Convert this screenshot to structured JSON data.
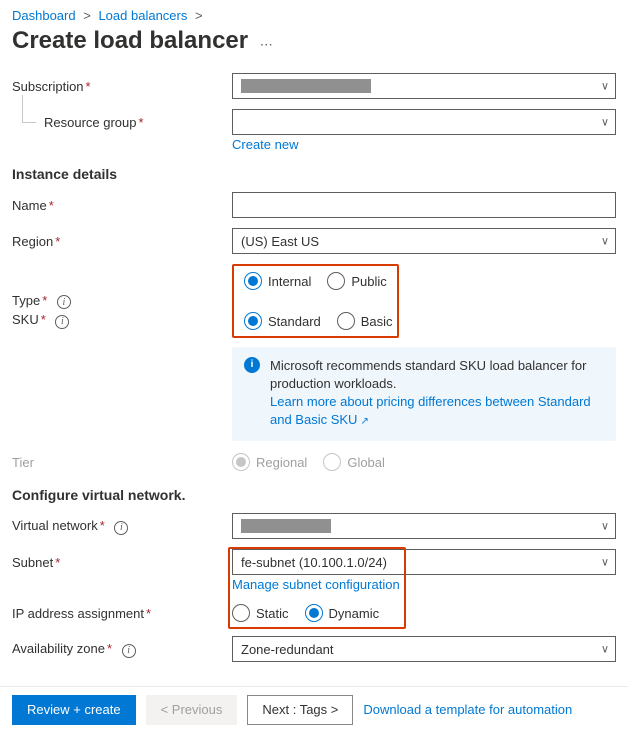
{
  "breadcrumb": {
    "item1": "Dashboard",
    "item2": "Load balancers"
  },
  "page_title": "Create load balancer",
  "labels": {
    "subscription": "Subscription",
    "resource_group": "Resource group",
    "create_new": "Create new",
    "instance_details": "Instance details",
    "name": "Name",
    "region": "Region",
    "type": "Type",
    "sku": "SKU",
    "tier": "Tier",
    "configure_vnet": "Configure virtual network.",
    "virtual_network": "Virtual network",
    "subnet": "Subnet",
    "manage_subnet": "Manage subnet configuration",
    "ip_assignment": "IP address assignment",
    "availability_zone": "Availability zone"
  },
  "values": {
    "region": "(US) East US",
    "subnet": "fe-subnet (10.100.1.0/24)",
    "availability_zone": "Zone-redundant"
  },
  "radios": {
    "type_internal": "Internal",
    "type_public": "Public",
    "sku_standard": "Standard",
    "sku_basic": "Basic",
    "tier_regional": "Regional",
    "tier_global": "Global",
    "ip_static": "Static",
    "ip_dynamic": "Dynamic"
  },
  "info": {
    "sku_msg": "Microsoft recommends standard SKU load balancer for production workloads.",
    "sku_link": "Learn more about pricing differences between Standard and Basic SKU"
  },
  "footer": {
    "review": "Review + create",
    "prev": "<  Previous",
    "next": "Next : Tags  >",
    "download": "Download a template for automation"
  }
}
